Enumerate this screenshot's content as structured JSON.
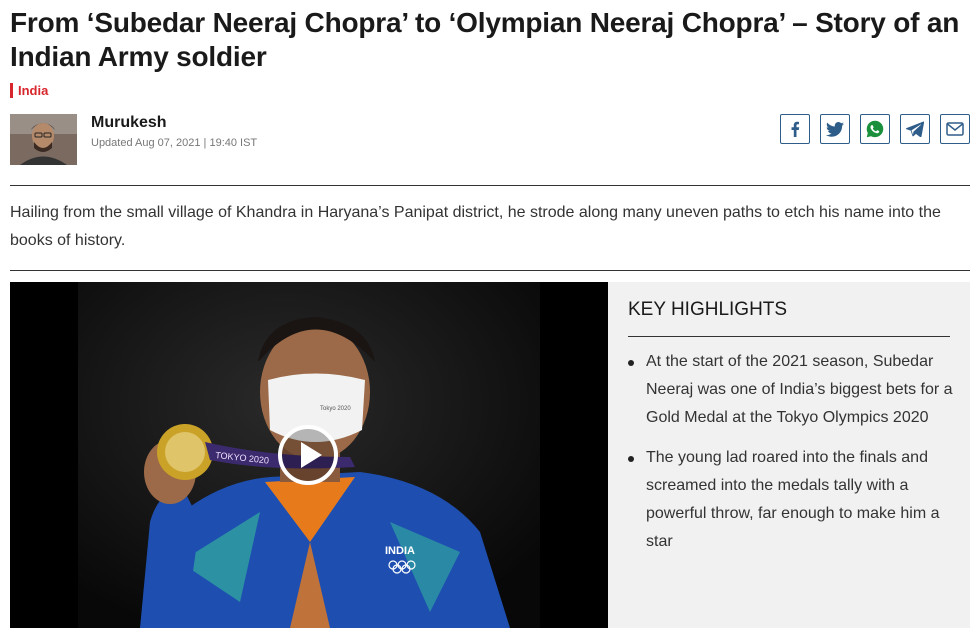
{
  "article": {
    "headline": "From ‘Subedar Neeraj Chopra’ to ‘Olympian Neeraj Chopra’ – Story of an Indian Army soldier",
    "category": "India",
    "summary": "Hailing from the small village of Khandra in Haryana’s Panipat district, he strode along many uneven paths to etch his name into the books of history."
  },
  "author": {
    "name": "Murukesh",
    "updated": "Updated Aug 07, 2021 | 19:40 IST"
  },
  "share": {
    "icons": [
      "facebook-icon",
      "twitter-icon",
      "whatsapp-icon",
      "telegram-icon",
      "email-icon"
    ],
    "color": "#2f5d8a"
  },
  "video": {
    "play_icon": "play-icon",
    "mask_text": "Tokyo 2020",
    "lanyard_text": "TOKYO 2020",
    "jacket_text": "INDIA"
  },
  "highlights": {
    "title": "KEY HIGHLIGHTS",
    "items": [
      "At the start of the 2021 season, Subedar Neeraj was one of India’s biggest bets for a Gold Medal at the Tokyo Olympics 2020",
      "The young lad roared into the finals and screamed into the medals tally with a powerful throw, far enough to make him a star"
    ]
  },
  "colors": {
    "accent": "#d7262c",
    "text": "#1a1a1a",
    "panel": "#f1f1f1"
  }
}
